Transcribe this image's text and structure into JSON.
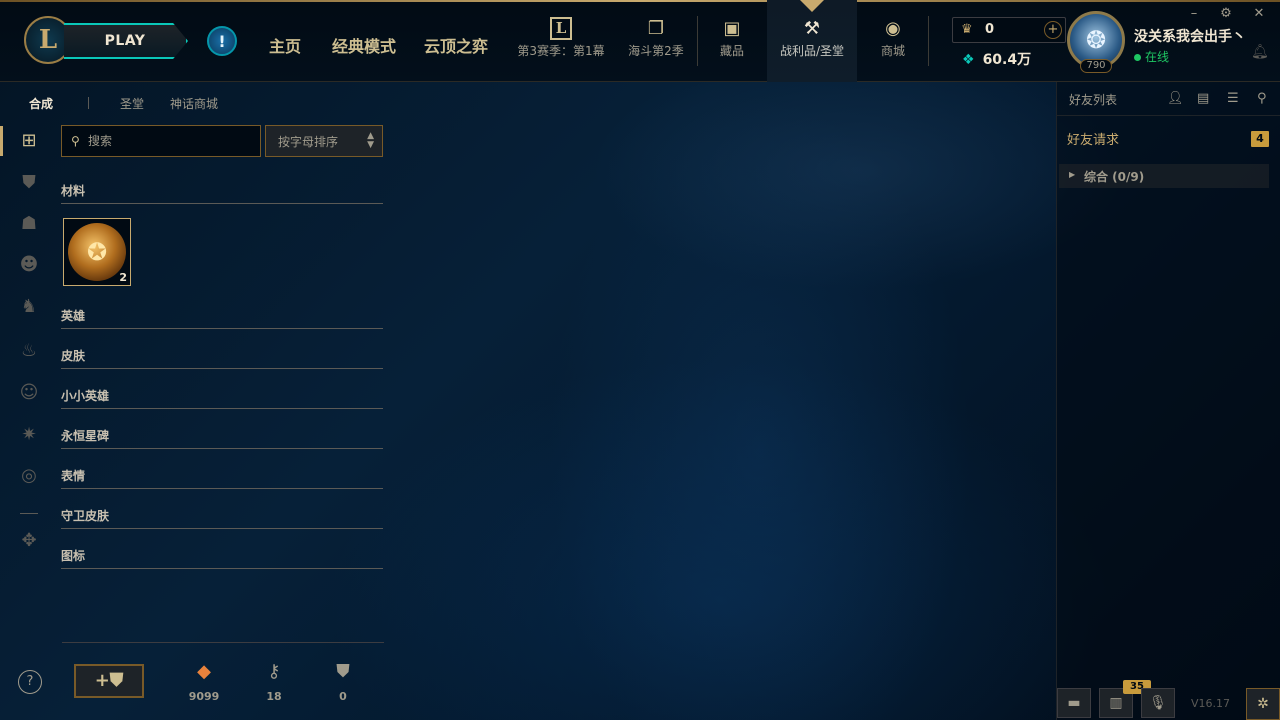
{
  "nav": {
    "play_label": "PLAY",
    "alert_icon": "!",
    "main": [
      "主页",
      "经典模式",
      "云顶之弈"
    ],
    "season_label": "第3赛季：第1幕",
    "clash_label": "海斗第2季",
    "collection_label": "藏品",
    "loot_label": "战利品/圣堂",
    "store_label": "商城"
  },
  "wallet": {
    "rp_value": "0",
    "be_value": "60.4万"
  },
  "profile": {
    "name": "没关系我会出手丶",
    "status": "在线",
    "level": "790"
  },
  "window": {
    "minimize": "–",
    "settings": "⚙",
    "close": "✕"
  },
  "loot": {
    "tabs": [
      "合成",
      "圣堂",
      "神话商城"
    ],
    "search_placeholder": "搜索",
    "sort_label": "按字母排序",
    "sections": {
      "materials": "材料",
      "champions": "英雄",
      "skins": "皮肤",
      "little_legends": "小小英雄",
      "eternals": "永恒星碑",
      "emotes": "表情",
      "ward_skins": "守卫皮肤",
      "icons": "图标"
    },
    "material_item_count": "2",
    "currencies": {
      "orange_essence": "9099",
      "keys": "18",
      "ward": "0"
    }
  },
  "social": {
    "title": "好友列表",
    "friend_requests": "好友请求",
    "friend_requests_count": "4",
    "group": "综合 (0/9)"
  },
  "dock": {
    "notifications_count": "35",
    "version": "V16.17"
  },
  "colors": {
    "gold": "#c8aa6e",
    "teal": "#0ac8b9",
    "online": "#1ec763",
    "badge": "#c89b3c"
  }
}
